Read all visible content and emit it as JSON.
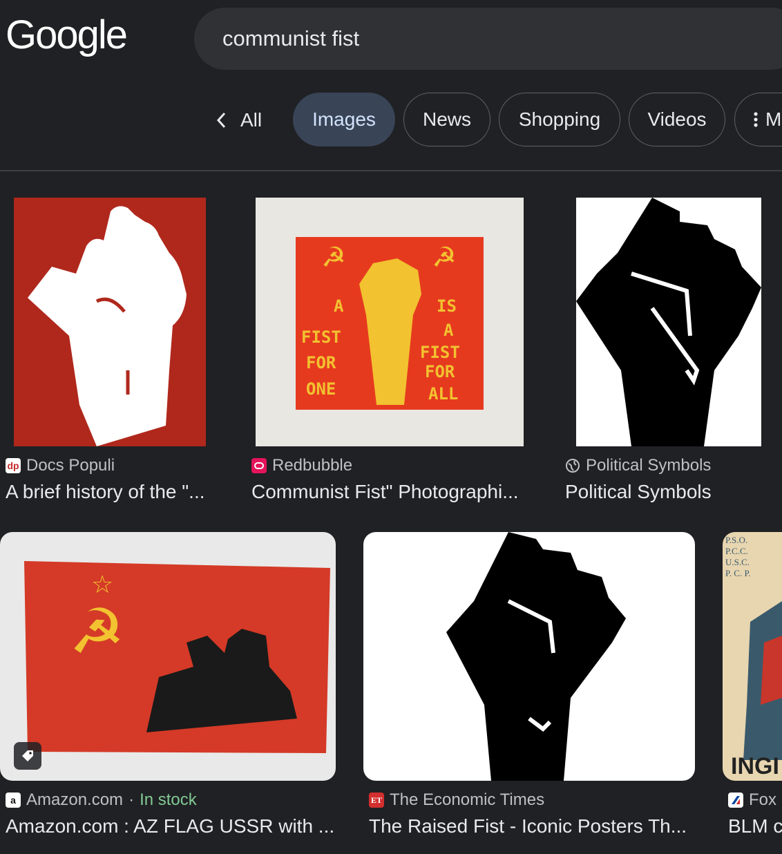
{
  "header": {
    "logo_text": "Google",
    "search_query": "communist fist"
  },
  "tabs": {
    "back_label": "All",
    "items": [
      {
        "label": "Images",
        "selected": true
      },
      {
        "label": "News"
      },
      {
        "label": "Shopping"
      },
      {
        "label": "Videos"
      },
      {
        "label": "M"
      }
    ]
  },
  "results": [
    {
      "source": "Docs Populi",
      "title": "A brief history of the \"...",
      "favicon": "dp"
    },
    {
      "source": "Redbubble",
      "title": "Communist Fist\" Photographi...",
      "poster_text": {
        "left": [
          "A",
          "FIST",
          "FOR",
          "ONE"
        ],
        "right": [
          "IS",
          "A",
          "FIST",
          "FOR",
          "ALL"
        ]
      }
    },
    {
      "source": "Political Symbols",
      "title": "Political Symbols"
    },
    {
      "source": "Amazon.com",
      "stock": "In stock",
      "separator": "·",
      "title": "Amazon.com : AZ FLAG USSR with ...",
      "favicon": "a"
    },
    {
      "source": "The Economic Times",
      "title": "The Raised Fist - Iconic Posters Th...",
      "favicon": "ET"
    },
    {
      "source": "Fox",
      "title": "BLM c",
      "poster_text": [
        "P.S.O.",
        "P.C.C.",
        "U.S.C.",
        "P. C. P.",
        "INGI"
      ]
    }
  ],
  "colors": {
    "background": "#202124",
    "search_box": "#303134",
    "chip_selected": "#394457",
    "soviet_red": "#b0281c",
    "poster_gold": "#f2c230",
    "in_stock": "#81c995"
  }
}
